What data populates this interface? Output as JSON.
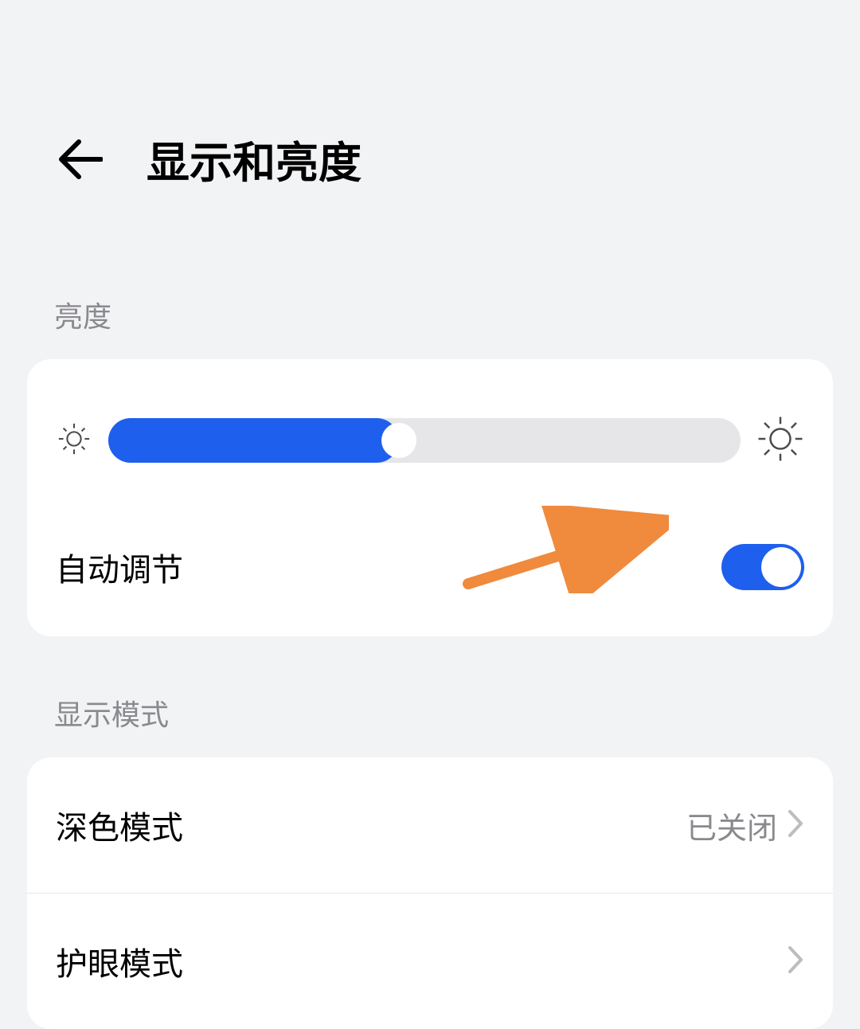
{
  "header": {
    "title": "显示和亮度"
  },
  "brightness": {
    "section_label": "亮度",
    "slider_percent": 46,
    "auto_label": "自动调节",
    "auto_enabled": true
  },
  "display_mode": {
    "section_label": "显示模式",
    "rows": [
      {
        "label": "深色模式",
        "value": "已关闭"
      },
      {
        "label": "护眼模式",
        "value": ""
      }
    ]
  },
  "icons": {
    "back": "back-arrow",
    "brightness_low": "brightness-low-icon",
    "brightness_high": "brightness-high-icon",
    "chevron": "chevron-right-icon"
  },
  "colors": {
    "accent": "#1e5fee",
    "background": "#f2f3f5",
    "card": "#ffffff",
    "text_secondary": "#8a8a8e",
    "annotation_arrow": "#f08a3c"
  }
}
